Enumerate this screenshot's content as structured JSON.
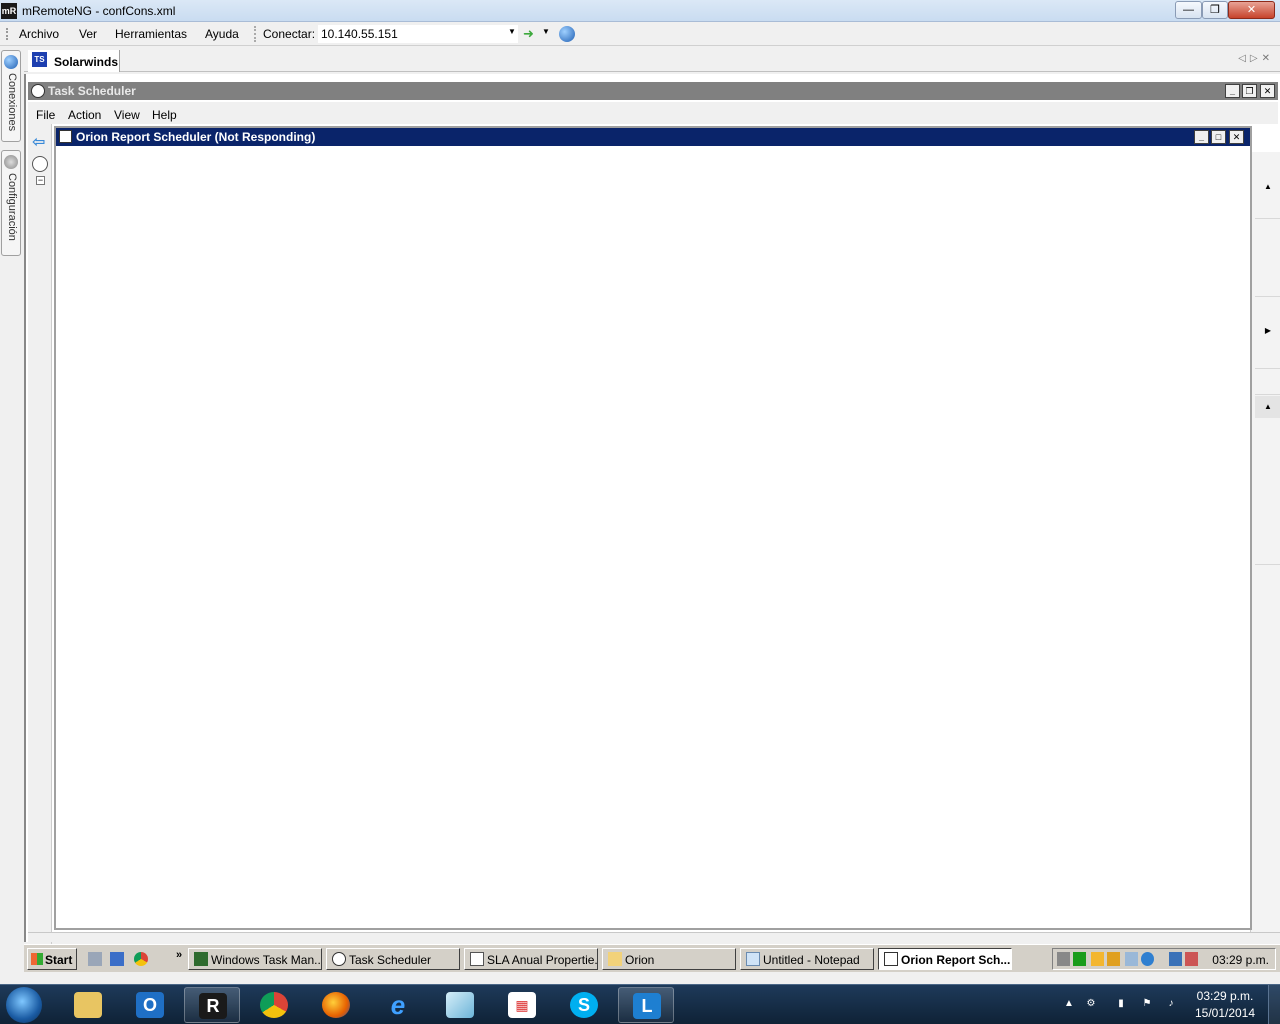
{
  "host_window": {
    "title": "mRemoteNG - confCons.xml",
    "app_icon_text": "mR"
  },
  "menubar": {
    "items": [
      "Archivo",
      "Ver",
      "Herramientas",
      "Ayuda"
    ],
    "connect_label": "Conectar:",
    "connect_value": "10.140.55.151"
  },
  "side_panel": {
    "tabs": [
      "Conexiones",
      "Configuración"
    ]
  },
  "doc_tab": {
    "icon_text": "TS",
    "label": "Solarwinds"
  },
  "mmc": {
    "title": "Task Scheduler",
    "menu": [
      "File",
      "Action",
      "View",
      "Help"
    ]
  },
  "child_window": {
    "title": "Orion Report Scheduler (Not Responding)"
  },
  "remote_taskbar": {
    "start_label": "Start",
    "tasks": [
      {
        "label": "Windows Task Man...",
        "active": false
      },
      {
        "label": "Task Scheduler",
        "active": false
      },
      {
        "label": "SLA Anual Propertie...",
        "active": false
      },
      {
        "label": "Orion",
        "active": false
      },
      {
        "label": "Untitled - Notepad",
        "active": false
      },
      {
        "label": "Orion Report Sch...",
        "active": true
      }
    ],
    "clock": "03:29 p.m."
  },
  "host_taskbar": {
    "pinned": [
      "explorer-icon",
      "outlook-icon",
      "mremoteng-icon",
      "chrome-icon",
      "firefox-icon",
      "ie-icon",
      "app-icon",
      "apps-grid-icon",
      "skype-icon",
      "lync-icon"
    ],
    "time": "03:29 p.m.",
    "date": "15/01/2014"
  }
}
